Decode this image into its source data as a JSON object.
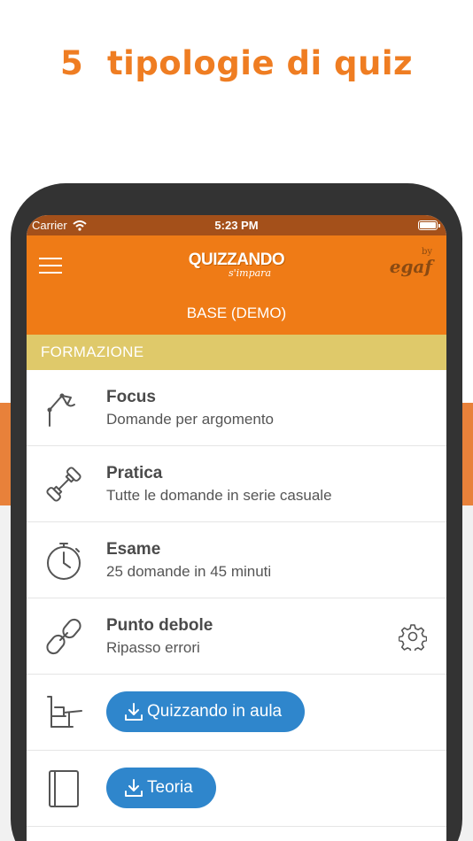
{
  "promo": {
    "title": "5  tipologie di quiz"
  },
  "status_bar": {
    "carrier": "Carrier",
    "time": "5:23 PM"
  },
  "app_bar": {
    "logo_main": "QUIZZANDO",
    "logo_tag": "s'impara",
    "byline_by": "by",
    "byline_brand": "egaf",
    "subtitle": "BASE (DEMO)"
  },
  "section": {
    "title": "FORMAZIONE"
  },
  "items": [
    {
      "title": "Focus",
      "desc": "Domande per argomento",
      "icon": "desk-lamp-icon"
    },
    {
      "title": "Pratica",
      "desc": "Tutte le domande in serie casuale",
      "icon": "dumbbell-icon"
    },
    {
      "title": "Esame",
      "desc": "25 domande in 45 minuti",
      "icon": "stopwatch-icon"
    },
    {
      "title": "Punto debole",
      "desc": "Ripasso errori",
      "icon": "chain-link-icon"
    }
  ],
  "actions": [
    {
      "label": "Quizzando in aula",
      "icon": "classroom-desk-icon"
    },
    {
      "label": "Teoria",
      "icon": "book-icon"
    }
  ],
  "colors": {
    "accent": "#ef7b16",
    "status_bar": "#a4501a",
    "section_header": "#dfc96a",
    "button": "#2f86cc",
    "promo_title": "#ef7d22"
  }
}
